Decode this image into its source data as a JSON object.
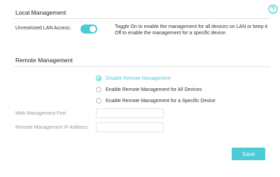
{
  "local_management": {
    "title": "Local Management",
    "unrestricted_lan_label": "Unrestricted LAN Access:",
    "toggle_state": "on",
    "toggle_description": "Toggle On to enable the management for all devices on LAN or keep it Off to enable the management for a specific device."
  },
  "remote_management": {
    "title": "Remote Management",
    "options": [
      {
        "label": "Disable Remote Management",
        "selected": true
      },
      {
        "label": "Enable Remote Management for All Devices",
        "selected": false
      },
      {
        "label": "Enable Remote Management for a Specific Device",
        "selected": false
      }
    ],
    "web_port_label": "Web Management Port:",
    "web_port_value": "",
    "ip_address_label": "Remote Management IP Address:",
    "ip_address_value": ""
  },
  "actions": {
    "save_label": "Save"
  },
  "icons": {
    "help": "help-icon"
  },
  "colors": {
    "accent": "#4acbd6",
    "divider": "#e2e2e2",
    "muted_label": "#9a9a9a"
  }
}
